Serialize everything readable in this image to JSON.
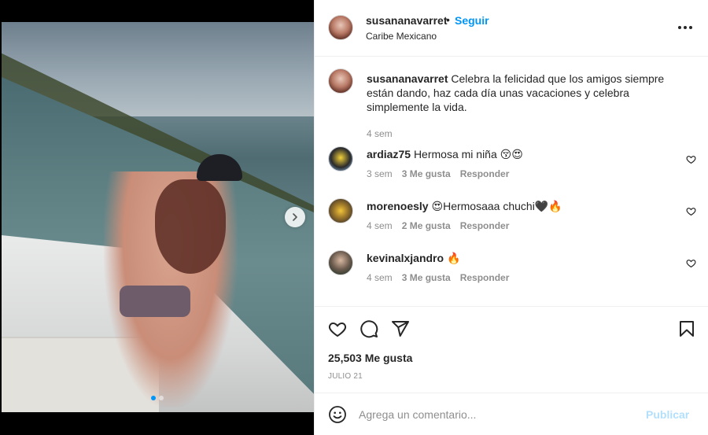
{
  "post": {
    "username": "susananavarret",
    "separator": "•",
    "follow_label": "Seguir",
    "location": "Caribe Mexicano",
    "caption_user": "susananavarret",
    "caption_text": "Celebra la felicidad que los amigos siempre están dando, haz cada día unas vacaciones y celebra simplemente la vida.",
    "caption_time": "4 sem",
    "carousel": {
      "total": 2,
      "active": 1
    }
  },
  "comments": [
    {
      "user": "ardiaz75",
      "text": "Hermosa mi niña 😚😍",
      "time": "3 sem",
      "likes": "3 Me gusta",
      "reply": "Responder"
    },
    {
      "user": "morenoesly",
      "text": "😍Hermosaaa chuchi🖤🔥",
      "time": "4 sem",
      "likes": "2 Me gusta",
      "reply": "Responder"
    },
    {
      "user": "kevinalxjandro",
      "text": "🔥",
      "time": "4 sem",
      "likes": "3 Me gusta",
      "reply": "Responder"
    }
  ],
  "actions": {
    "likes_count": "25,503 Me gusta",
    "date": "JULIO 21",
    "icons": [
      "heart-icon",
      "comment-icon",
      "share-icon",
      "bookmark-icon"
    ]
  },
  "composer": {
    "placeholder": "Agrega un comentario...",
    "publish_label": "Publicar"
  },
  "colors": {
    "accent": "#0095f6",
    "publish_disabled": "#b2dffc",
    "muted_text": "#8e8e8e",
    "primary_text": "#262626"
  }
}
